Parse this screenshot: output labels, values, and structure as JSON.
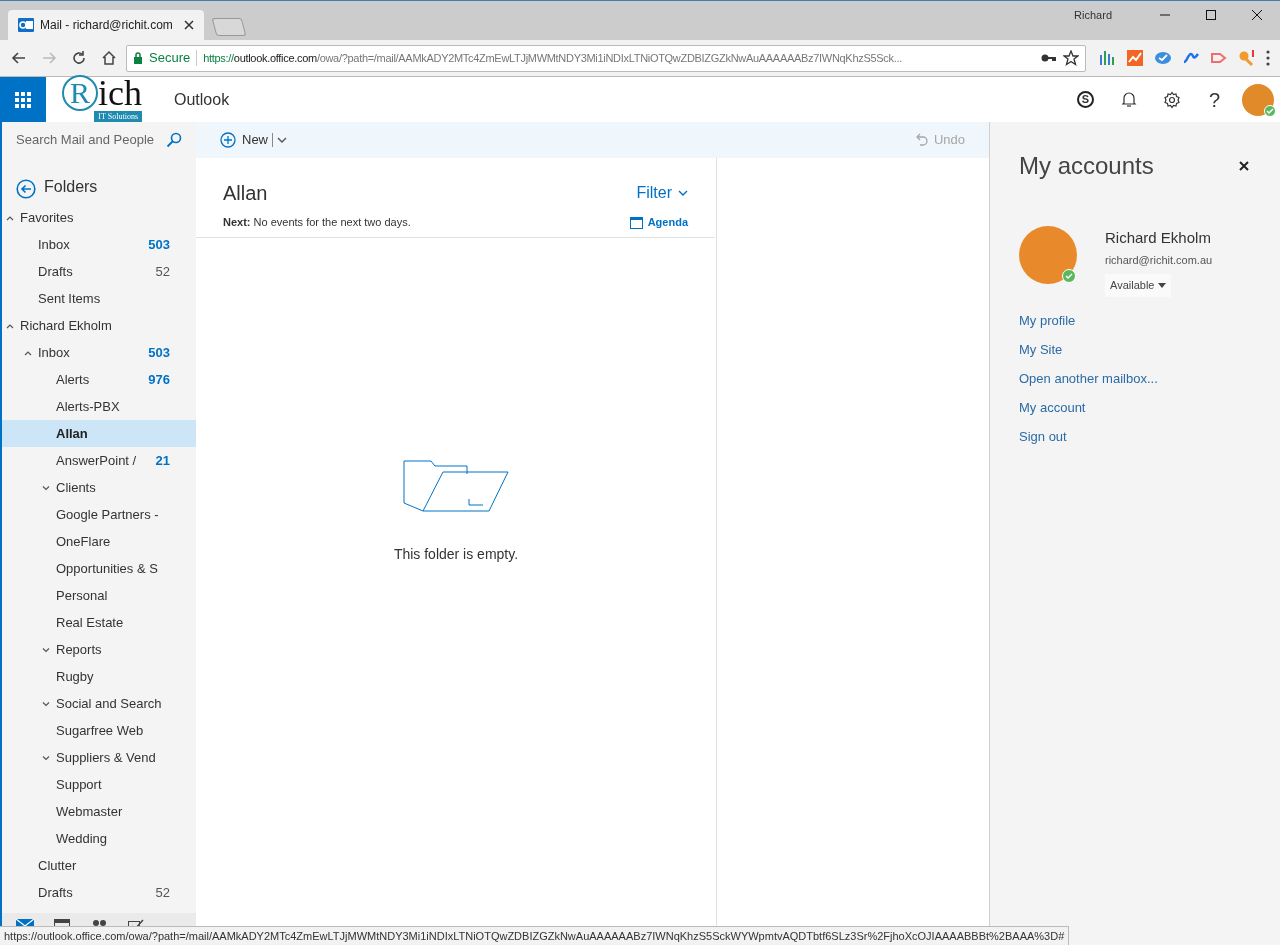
{
  "browser": {
    "tab_title": "Mail - richard@richit.com",
    "profile_name": "Richard",
    "secure_label": "Secure",
    "url_parts": [
      "https://",
      "outlook.office.com",
      "/owa/?path=/mail/AAMkADY2MTc4ZmEwLTJjMWMtNDY3Mi1iNDIxLTNiOTQwZDBIZGZkNwAuAAAAAABz7IWNqKhzS5Sck..."
    ],
    "status_url": "https://outlook.office.com/owa/?path=/mail/AAMkADY2MTc4ZmEwLTJjMWMtNDY3Mi1iNDIxLTNiOTQwZDBIZGZkNwAuAAAAAABz7IWNqKhzS5SckWYWpmtvAQDTbtf6SLz3Sr%2FjhoXcOJIAAAABBBt%2BAAA%3D#"
  },
  "header": {
    "logo_mark": "R",
    "logo_word": "ich",
    "logo_tagline": "IT Solutions",
    "app_name": "Outlook",
    "skype_glyph": "S",
    "help_glyph": "?"
  },
  "sidebar": {
    "search_placeholder": "Search Mail and People",
    "folders_label": "Folders",
    "tree": [
      {
        "name": "Favorites",
        "expanded": true,
        "children": [
          {
            "name": "Inbox",
            "count": "503",
            "unread": true,
            "selected": false
          },
          {
            "name": "Drafts",
            "count": "52",
            "unread": false,
            "selected": false
          },
          {
            "name": "Sent Items",
            "selected": false
          }
        ]
      },
      {
        "name": "Richard Ekholm",
        "expanded": true,
        "children": [
          {
            "name": "Inbox",
            "count": "503",
            "unread": true,
            "selected": false,
            "expanded": true,
            "children": [
              {
                "name": "Alerts",
                "count": "976",
                "unread": true,
                "selected": false
              },
              {
                "name": "Alerts-PBX",
                "selected": false
              },
              {
                "name": "Allan",
                "selected": true
              },
              {
                "name": "AnswerPoint /",
                "count": "21",
                "unread": true,
                "selected": false
              },
              {
                "name": "Clients",
                "selected": false,
                "expanded": false
              },
              {
                "name": "Google Partners -",
                "selected": false
              },
              {
                "name": "OneFlare",
                "selected": false
              },
              {
                "name": "Opportunities & S",
                "selected": false
              },
              {
                "name": "Personal",
                "selected": false
              },
              {
                "name": "Real Estate",
                "selected": false
              },
              {
                "name": "Reports",
                "selected": false,
                "expanded": false
              },
              {
                "name": "Rugby",
                "selected": false
              },
              {
                "name": "Social and Search",
                "selected": false,
                "expanded": false
              },
              {
                "name": "Sugarfree Web",
                "selected": false
              },
              {
                "name": "Suppliers & Vend",
                "selected": false,
                "expanded": false
              },
              {
                "name": "Support",
                "selected": false
              },
              {
                "name": "Webmaster",
                "selected": false
              },
              {
                "name": "Wedding",
                "selected": false
              }
            ]
          },
          {
            "name": "Clutter",
            "selected": false
          },
          {
            "name": "Drafts",
            "count": "52",
            "unread": false,
            "selected": false
          }
        ]
      }
    ]
  },
  "toolbar": {
    "new_label": "New",
    "undo_label": "Undo",
    "undo_disabled": true
  },
  "message_list": {
    "folder_title": "Allan",
    "filter_label": "Filter",
    "next_events": "**Next:** No events for the next two days.",
    "agenda_label": "Agenda",
    "empty_text": "This folder is empty."
  },
  "accounts_panel": {
    "title": "My accounts",
    "name": "Richard Ekholm",
    "email": "richard@richit.com.au",
    "status": "Available",
    "links": [
      "My profile",
      "My Site",
      "Open another mailbox...",
      "My account",
      "Sign out"
    ]
  }
}
